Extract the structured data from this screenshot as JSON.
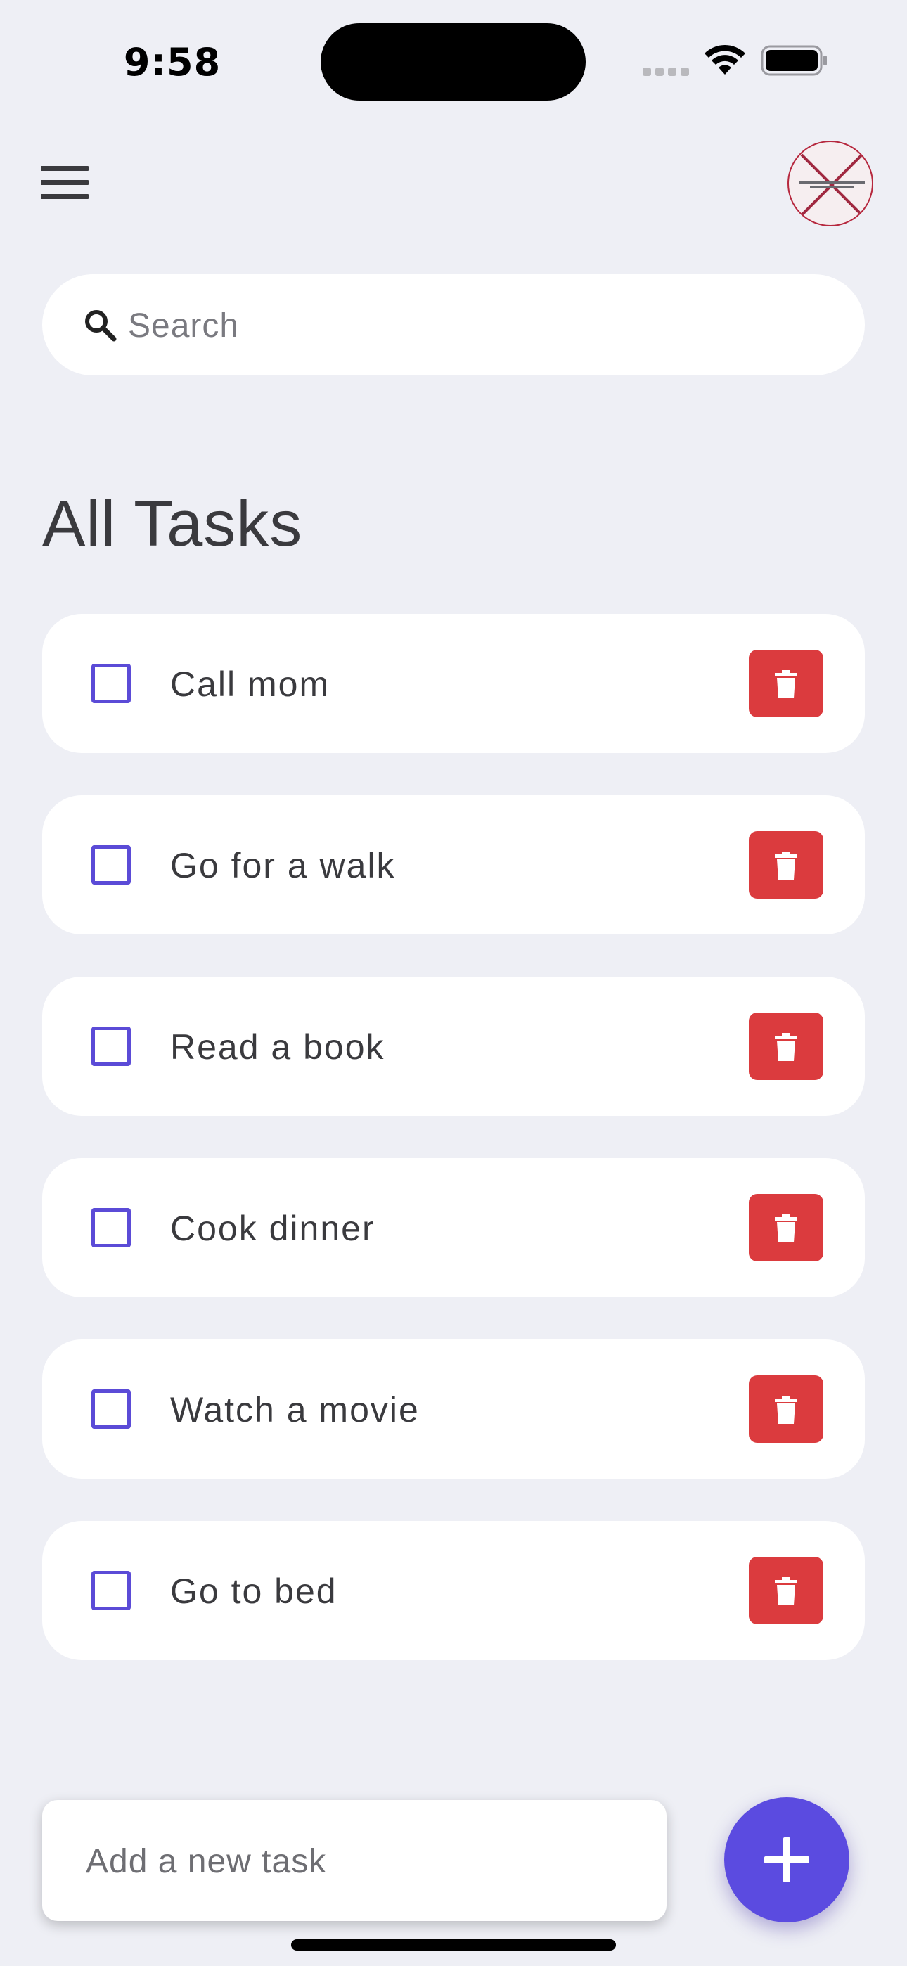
{
  "status_bar": {
    "time": "9:58"
  },
  "header": {
    "menu_icon": "hamburger-menu-icon",
    "avatar_icon": "broken-image-avatar"
  },
  "search": {
    "placeholder": "Search",
    "icon": "search-icon"
  },
  "main": {
    "title": "All Tasks",
    "tasks": [
      {
        "label": "Call mom",
        "checked": false
      },
      {
        "label": "Go for a walk",
        "checked": false
      },
      {
        "label": "Read a book",
        "checked": false
      },
      {
        "label": "Cook dinner",
        "checked": false
      },
      {
        "label": "Watch a movie",
        "checked": false
      },
      {
        "label": "Go to bed",
        "checked": false
      }
    ],
    "delete_icon": "trash-icon"
  },
  "footer": {
    "input_placeholder": "Add a new task",
    "add_icon": "plus-icon"
  },
  "colors": {
    "background": "#EEEFF5",
    "accent": "#5B4BE0",
    "delete": "#DB3B3E",
    "text": "#3A3A3E"
  }
}
